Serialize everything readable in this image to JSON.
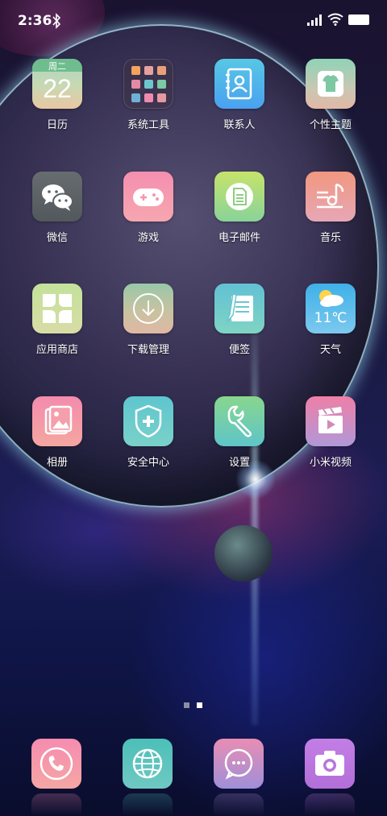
{
  "status_bar": {
    "time": "2:36",
    "icons": [
      "bluetooth-icon",
      "signal-icon",
      "wifi-icon",
      "battery-icon"
    ]
  },
  "calendar_tile": {
    "weekday": "周二",
    "day": "22"
  },
  "weather_tile": {
    "temperature": "11℃",
    "icon": "partly-cloudy-icon"
  },
  "apps": [
    {
      "label": "日历",
      "icon": "calendar-icon"
    },
    {
      "label": "系统工具",
      "icon": "folder-icon"
    },
    {
      "label": "联系人",
      "icon": "contacts-icon"
    },
    {
      "label": "个性主题",
      "icon": "theme-shirt-icon"
    },
    {
      "label": "微信",
      "icon": "wechat-icon"
    },
    {
      "label": "游戏",
      "icon": "gamepad-icon"
    },
    {
      "label": "电子邮件",
      "icon": "email-icon"
    },
    {
      "label": "音乐",
      "icon": "music-icon"
    },
    {
      "label": "应用商店",
      "icon": "app-store-icon"
    },
    {
      "label": "下载管理",
      "icon": "download-icon"
    },
    {
      "label": "便签",
      "icon": "notes-icon"
    },
    {
      "label": "天气",
      "icon": "weather-icon"
    },
    {
      "label": "相册",
      "icon": "gallery-icon"
    },
    {
      "label": "安全中心",
      "icon": "shield-icon"
    },
    {
      "label": "设置",
      "icon": "wrench-icon"
    },
    {
      "label": "小米视频",
      "icon": "video-icon"
    }
  ],
  "dock": [
    {
      "icon": "phone-icon"
    },
    {
      "icon": "browser-icon"
    },
    {
      "icon": "messages-icon"
    },
    {
      "icon": "camera-icon"
    }
  ],
  "page_indicator": {
    "pages": 2,
    "current": 2
  },
  "colors": {
    "accent_rim": "#bfefff",
    "background": "#1a1a3c"
  }
}
